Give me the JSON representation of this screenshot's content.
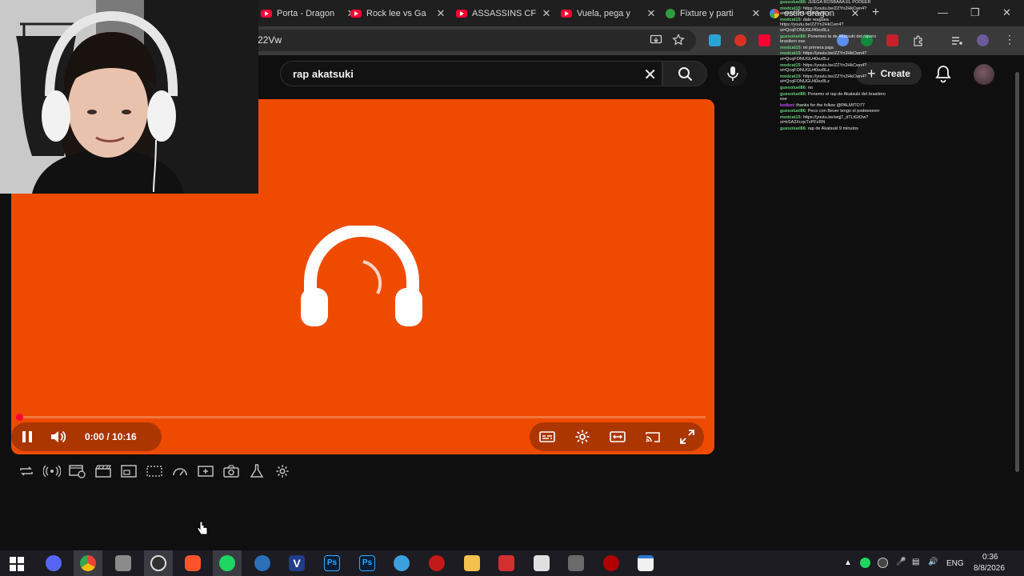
{
  "browser": {
    "tabs": [
      {
        "label": "Porta - Dragon",
        "icon": "youtube-icon",
        "close": "✕"
      },
      {
        "label": "Rock lee vs Ga",
        "icon": "youtube-icon",
        "close": "✕"
      },
      {
        "label": "ASSASSINS CF",
        "icon": "youtube-icon",
        "close": "✕"
      },
      {
        "label": "Vuela, pega y",
        "icon": "youtube-icon",
        "close": "✕"
      },
      {
        "label": "Fixture y parti",
        "icon": "soccer-icon",
        "close": "✕"
      },
      {
        "label": "estilo dragon",
        "icon": "google-icon",
        "close": "✕"
      }
    ],
    "new_tab": "+",
    "url_visible": "22Vw"
  },
  "youtube": {
    "search_query": "rap akatsuki",
    "create_label": "Create"
  },
  "player": {
    "time": "0:00 / 10:16",
    "progress_fraction": 0.0,
    "state": "playing"
  },
  "chat": [
    {
      "user": "guesoluel86",
      "text": "JUEGA ROSBAAA EL PODEER"
    },
    {
      "user": "modcat15",
      "text": "https://youtu.be/ZZYn2HkCwn4?si=QcqFONUGU40ez8Lz"
    },
    {
      "user": "modcat15",
      "text": "dale reaguea https://youtu.be/ZZYn2HkCwn4?si=QcqFONUGU40ez8Lz"
    },
    {
      "user": "guesoluel86",
      "text": "Ponemeo la de Akatsuki del rapero brasilero ese"
    },
    {
      "user": "modcat15",
      "text": "mi primera paja"
    },
    {
      "user": "modcat15",
      "text": "https://youtu.be/ZZYn2HkCwn4?si=QcqFONUGU40ez8Lz"
    },
    {
      "user": "modcat15",
      "text": "https://youtu.be/ZZYn2HkCwn4?si=QcqFONUGU40ez8Lz"
    },
    {
      "user": "modcat15",
      "text": "https://youtu.be/ZZYn2HkCwn4?si=QcqFONUGU40ez8Lz"
    },
    {
      "user": "guesoluel86",
      "text": "no"
    },
    {
      "user": "guesoluel86",
      "text": "Ponemo el rap de Akatsuki del brasilero ese"
    },
    {
      "user": "botbot",
      "text": "thanks for the follow @PALMITO77"
    },
    {
      "user": "guesoluel86",
      "text": "Peco con Bever tengo el podeeeeerr"
    },
    {
      "user": "modcat15",
      "text": "https://youtu.be/wqj7_dTLtGtOw?si=kSA3XcqvTxPFzRN"
    },
    {
      "user": "guesoluel86",
      "text": "rap de Akatsuki 9 minutos"
    }
  ],
  "taskbar": {
    "language": "ENG",
    "time": "0:36",
    "date": "8/8/2026"
  },
  "colors": {
    "player_bg": "#ee4b00",
    "youtube_red": "#ff0033",
    "page_bg": "#0f0f0f"
  }
}
